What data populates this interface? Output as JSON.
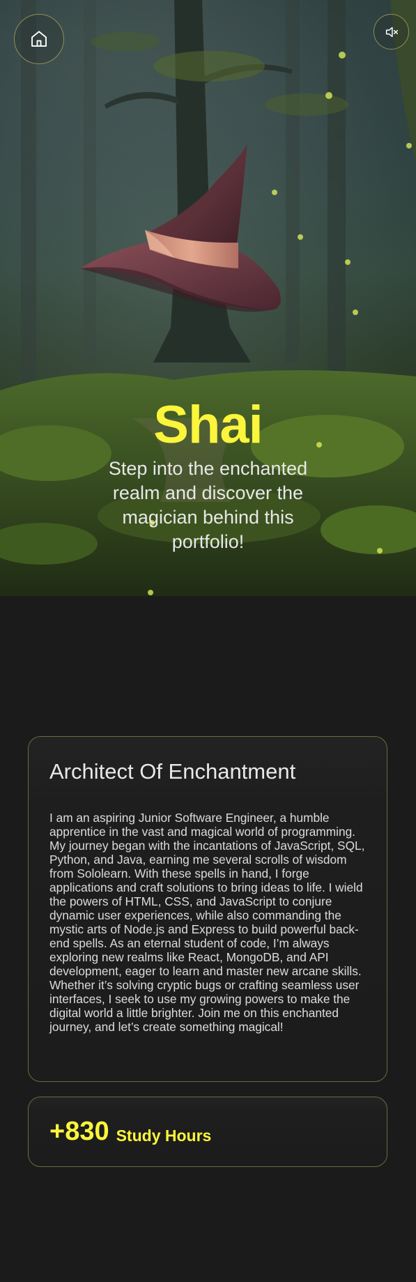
{
  "nav": {
    "home_icon": "home-icon",
    "sound_icon": "speaker-muted-icon"
  },
  "hero": {
    "name": "Shai",
    "tagline": "Step into the enchanted realm and discover the magician behind this portfolio!",
    "accent_color": "#fbf53c"
  },
  "about": {
    "title": "Architect Of Enchantment",
    "body": "I am an aspiring Junior Software Engineer, a humble apprentice in the vast and magical world of programming. My journey began with the incantations of JavaScript, SQL, Python, and Java, earning me several scrolls of wisdom from Sololearn. With these spells in hand, I forge applications and craft solutions to bring ideas to life. I wield the powers of HTML, CSS, and JavaScript to conjure dynamic user experiences, while also commanding the mystic arts of Node.js and Express to build powerful back-end spells. As an eternal student of code, I’m always exploring new realms like React, MongoDB, and API development, eager to learn and master new arcane skills. Whether it’s solving cryptic bugs or crafting seamless user interfaces, I seek to use my growing powers to make the digital world a little brighter. Join me on this enchanted journey, and let’s create something magical!"
  },
  "stats": {
    "value": "+830",
    "label": "Study Hours"
  }
}
